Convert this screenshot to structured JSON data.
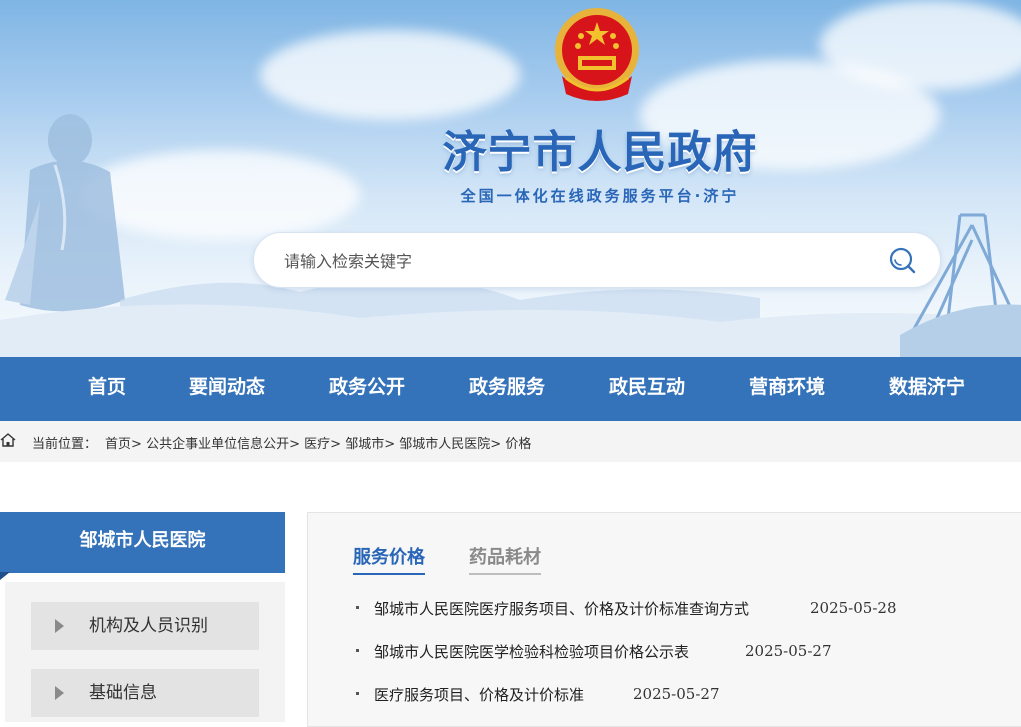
{
  "header": {
    "title": "济宁市人民政府",
    "subtitle": "全国一体化在线政务服务平台·济宁"
  },
  "search": {
    "placeholder": "请输入检索关键字"
  },
  "nav": {
    "items": [
      "首页",
      "要闻动态",
      "政务公开",
      "政务服务",
      "政民互动",
      "营商环境",
      "数据济宁"
    ]
  },
  "breadcrumb": {
    "label": "当前位置：",
    "items": [
      "首页",
      "公共企事业单位信息公开",
      "医疗",
      "邹城市",
      "邹城市人民医院",
      "价格"
    ],
    "separator": ">"
  },
  "sidebar": {
    "title": "邹城市人民医院",
    "items": [
      "机构及人员识别",
      "基础信息"
    ]
  },
  "tabs": [
    "服务价格",
    "药品耗材"
  ],
  "list": [
    {
      "title": "邹城市人民医院医疗服务项目、价格及计价标准查询方式",
      "date": "2025-05-28"
    },
    {
      "title": "邹城市人民医院医学检验科检验项目价格公示表",
      "date": "2025-05-27"
    },
    {
      "title": "医疗服务项目、价格及计价标准",
      "date": "2025-05-27"
    }
  ],
  "colors": {
    "primary": "#3472b9",
    "title_blue": "#2a66b8",
    "emblem_red": "#d7141a",
    "emblem_gold": "#f2c12e"
  }
}
